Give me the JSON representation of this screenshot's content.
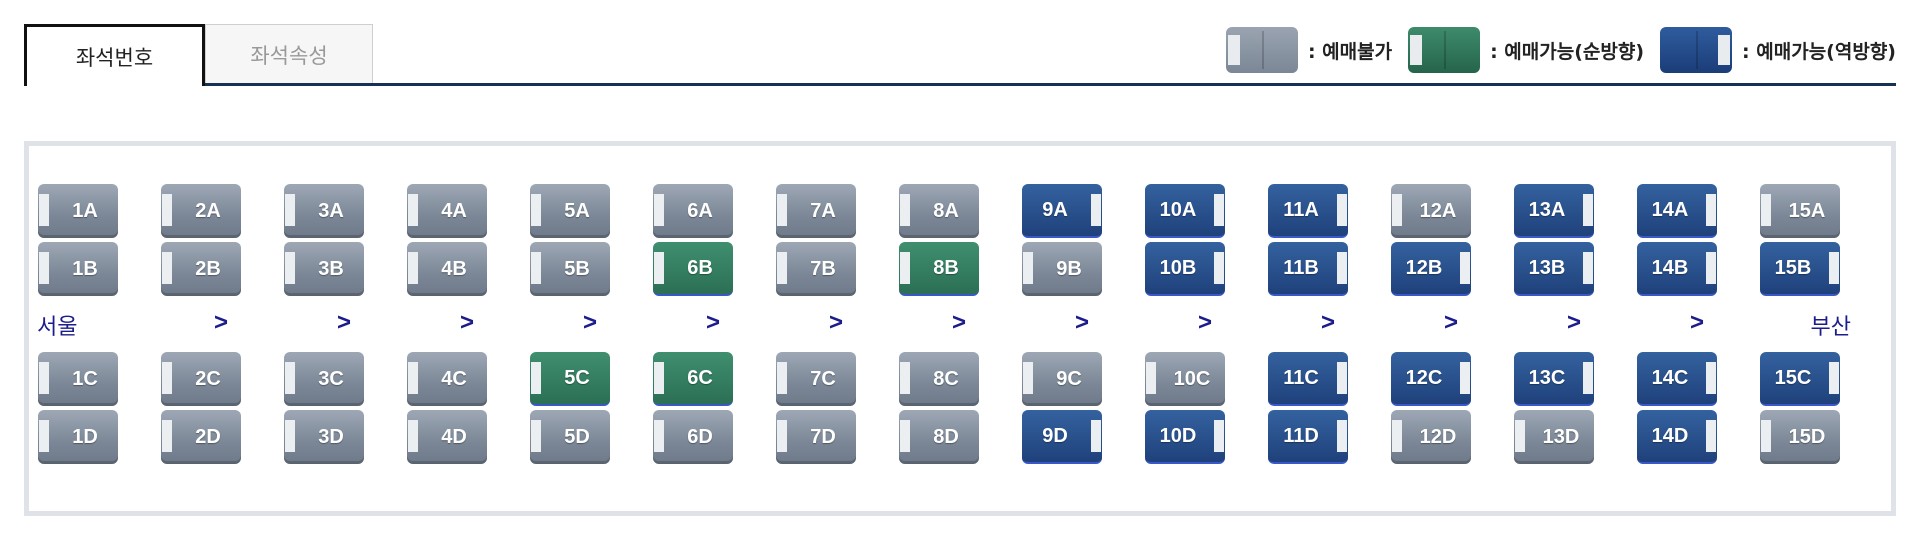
{
  "tabs": [
    {
      "label": "좌석번호",
      "active": true
    },
    {
      "label": "좌석속성",
      "active": false
    }
  ],
  "legend": [
    {
      "type": "unavailable",
      "label": ": 예매불가"
    },
    {
      "type": "forward",
      "label": ": 예매가능(순방향)"
    },
    {
      "type": "reverse",
      "label": ": 예매가능(역방향)"
    }
  ],
  "colors": {
    "unavailable": "#7b8796",
    "forward": "#2b6f55",
    "reverse": "#1f417b",
    "direction_text": "#1c1c8c",
    "tab_line": "#163253"
  },
  "direction": {
    "origin": "서울",
    "destination": "부산",
    "arrow": ">"
  },
  "rows": [
    {
      "letter": "A",
      "states": [
        "unavailable",
        "unavailable",
        "unavailable",
        "unavailable",
        "unavailable",
        "unavailable",
        "unavailable",
        "unavailable",
        "reverse",
        "reverse",
        "reverse",
        "unavailable",
        "reverse",
        "reverse",
        "unavailable"
      ]
    },
    {
      "letter": "B",
      "states": [
        "unavailable",
        "unavailable",
        "unavailable",
        "unavailable",
        "unavailable",
        "forward",
        "unavailable",
        "forward",
        "unavailable",
        "reverse",
        "reverse",
        "reverse",
        "reverse",
        "reverse",
        "reverse"
      ]
    },
    {
      "letter": "C",
      "states": [
        "unavailable",
        "unavailable",
        "unavailable",
        "unavailable",
        "forward",
        "forward",
        "unavailable",
        "unavailable",
        "unavailable",
        "unavailable",
        "reverse",
        "reverse",
        "reverse",
        "reverse",
        "reverse"
      ]
    },
    {
      "letter": "D",
      "states": [
        "unavailable",
        "unavailable",
        "unavailable",
        "unavailable",
        "unavailable",
        "unavailable",
        "unavailable",
        "unavailable",
        "reverse",
        "reverse",
        "reverse",
        "unavailable",
        "unavailable",
        "reverse",
        "unavailable"
      ]
    }
  ],
  "seat_labels": {
    "A": [
      "1A",
      "2A",
      "3A",
      "4A",
      "5A",
      "6A",
      "7A",
      "8A",
      "9A",
      "10A",
      "11A",
      "12A",
      "13A",
      "14A",
      "15A"
    ],
    "B": [
      "1B",
      "2B",
      "3B",
      "4B",
      "5B",
      "6B",
      "7B",
      "8B",
      "9B",
      "10B",
      "11B",
      "12B",
      "13B",
      "14B",
      "15B"
    ],
    "C": [
      "1C",
      "2C",
      "3C",
      "4C",
      "5C",
      "6C",
      "7C",
      "8C",
      "9C",
      "10C",
      "11C",
      "12C",
      "13C",
      "14C",
      "15C"
    ],
    "D": [
      "1D",
      "2D",
      "3D",
      "4D",
      "5D",
      "6D",
      "7D",
      "8D",
      "9D",
      "10D",
      "11D",
      "12D",
      "13D",
      "14D",
      "15D"
    ]
  },
  "icons": {
    "seat_cushion": "seat-cushion-icon",
    "arrow": "chevron-right-icon"
  }
}
